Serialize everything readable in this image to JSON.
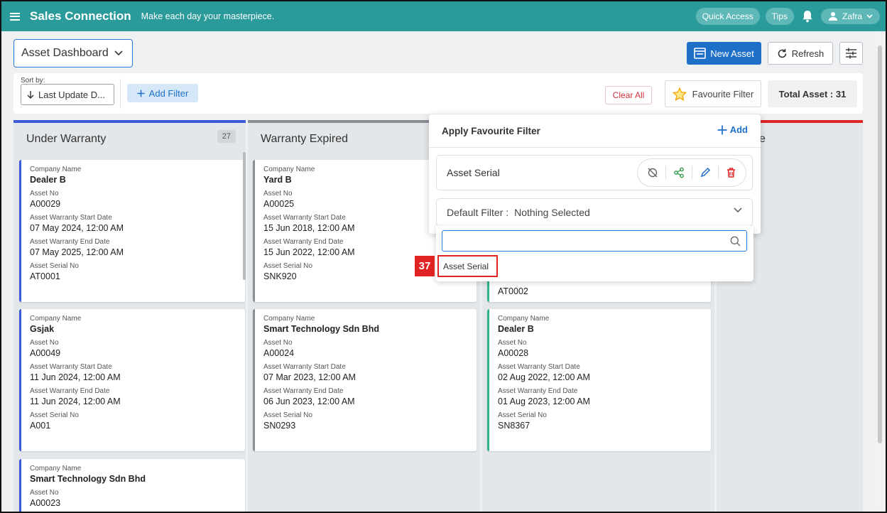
{
  "topbar": {
    "app_name": "Sales Connection",
    "tagline": "Make each day your masterpiece.",
    "quick_access": "Quick Access",
    "tips": "Tips",
    "user": "Zafra"
  },
  "header": {
    "dashboard_select": "Asset Dashboard",
    "new_asset": "New Asset",
    "refresh": "Refresh"
  },
  "filterbar": {
    "sort_label": "Sort by:",
    "sort_value": "Last Update D...",
    "add_filter": "Add Filter",
    "clear_all": "Clear All",
    "favourite_filter": "Favourite Filter",
    "total_asset": "Total Asset : 31"
  },
  "labels": {
    "company": "Company Name",
    "asset_no": "Asset No",
    "start": "Asset Warranty Start Date",
    "end": "Asset Warranty End Date",
    "serial": "Asset Serial No"
  },
  "columns": [
    {
      "title": "Under Warranty",
      "count": "27",
      "color": "#3b5bd9",
      "cards": [
        {
          "company": "Dealer B",
          "asset_no": "A00029",
          "start": "07 May 2024, 12:00 AM",
          "end": "07 May 2025, 12:00 AM",
          "serial": "AT0001"
        },
        {
          "company": "Gsjak",
          "asset_no": "A00049",
          "start": "11 Jun 2024, 12:00 AM",
          "end": "11 Jun 2024, 12:00 AM",
          "serial": "A001"
        },
        {
          "company": "Smart Technology Sdn Bhd",
          "asset_no": "A00023"
        }
      ]
    },
    {
      "title": "Warranty Expired",
      "color": "#8a8f95",
      "cards": [
        {
          "company": "Yard B",
          "asset_no": "A00025",
          "start": "15 Jun 2018, 12:00 AM",
          "end": "15 Jun 2022, 12:00 AM",
          "serial": "SNK920"
        },
        {
          "company": "Smart Technology Sdn Bhd",
          "asset_no": "A00024",
          "start": "07 Mar 2023, 12:00 AM",
          "end": "06 Jun 2023, 12:00 AM",
          "serial": "SN0293"
        }
      ]
    },
    {
      "color": "#8a8f95",
      "cards": [
        {
          "serial": "AT0002"
        },
        {
          "company": "Dealer B",
          "asset_no": "A00028",
          "start": "02 Aug 2022, 12:00 AM",
          "end": "01 Aug 2023, 12:00 AM",
          "serial": "SN8367"
        }
      ]
    },
    {
      "title_fragment": "e",
      "color": "#e02424"
    }
  ],
  "fav_popup": {
    "title": "Apply Favourite Filter",
    "add": "Add",
    "item": "Asset Serial",
    "default_label": "Default Filter :",
    "default_value": "Nothing Selected",
    "search_placeholder": "",
    "option": "Asset Serial",
    "badge": "37"
  }
}
